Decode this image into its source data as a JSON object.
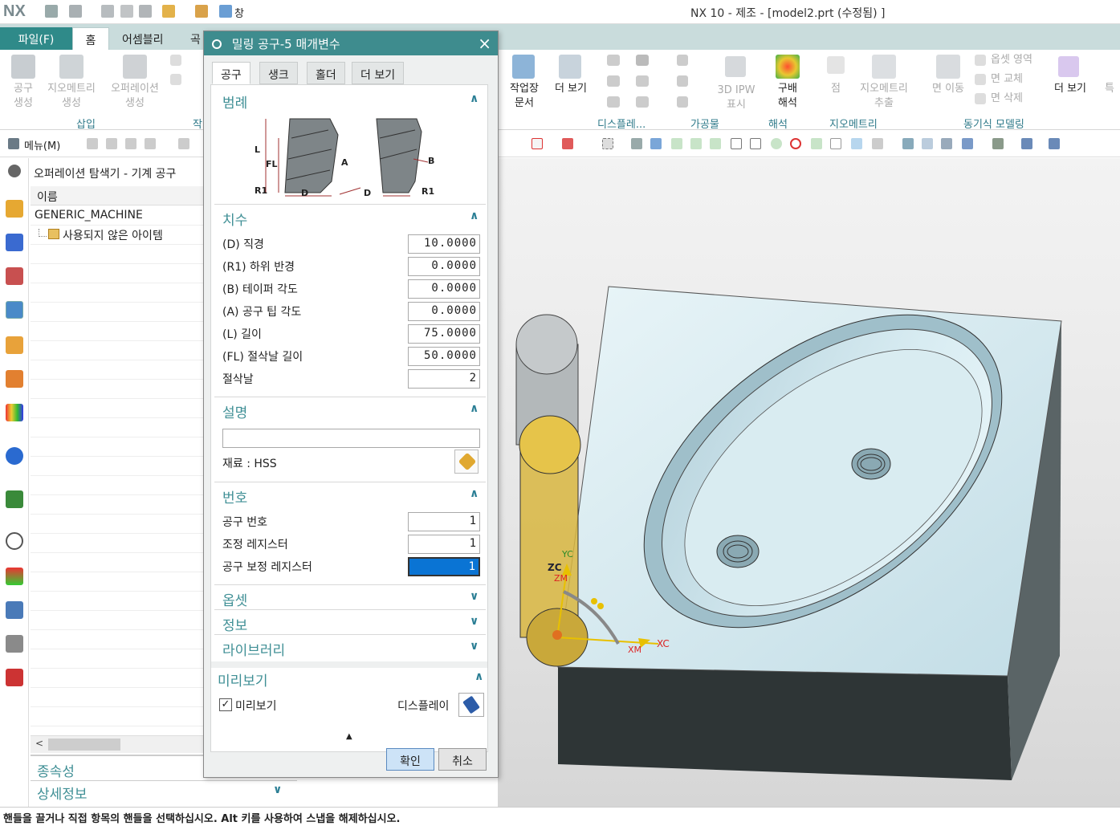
{
  "app": {
    "logo": "NX",
    "title": "NX 10 - 제조 - [model2.prt (수정됨) ]",
    "quick_access": [
      "save-icon",
      "undo-icon",
      "cut-icon",
      "copy-icon",
      "paste-icon",
      "update-icon",
      "window-label"
    ],
    "window_menu": "창"
  },
  "tabs": {
    "file": "파일(F)",
    "home": "홈",
    "assembly": "어셈블리",
    "more": "곡"
  },
  "ribbon": {
    "create_tool": "공구\n생성",
    "create_geometry": "지오메트리\n생성",
    "create_operation": "오퍼레이션\n생성",
    "group_insert": "삽입",
    "group_insert_cut": "작",
    "shop_doc": "작업장\n문서",
    "more_view": "더 보기",
    "group_display": "디스플레...",
    "ipw": "3D IPW\n표시",
    "group_machining": "가공물",
    "draft_analysis": "구배\n해석",
    "group_analysis": "해석",
    "point": "점",
    "extract_geometry": "지오메트리\n추출",
    "group_geometry": "지오메트리",
    "move_face": "면 이동",
    "offset_region": "옵셋 영역",
    "replace_face": "면 교체",
    "delete_face": "면 삭제",
    "group_sync": "동기식 모델링",
    "more_view2": "더 보기",
    "special": "특"
  },
  "menu_btn": "메뉴(M)",
  "navigator": {
    "title": "오퍼레이션 탐색기 - 기계 공구",
    "column_name": "이름",
    "rows": [
      "GENERIC_MACHINE",
      "사용되지 않은 아이템"
    ],
    "dependencies": "종속성",
    "details": "상세정보"
  },
  "dialog": {
    "title": "밀링 공구-5 매개변수",
    "tabs": [
      "공구",
      "생크",
      "홀더",
      "더 보기"
    ],
    "legend": {
      "title": "범례",
      "labels": [
        "L",
        "FL",
        "R1",
        "D",
        "A",
        "B",
        "D",
        "R1"
      ]
    },
    "dimensions": {
      "title": "치수",
      "rows": [
        {
          "label": "(D) 직경",
          "value": "10.0000"
        },
        {
          "label": "(R1) 하위 반경",
          "value": "0.0000"
        },
        {
          "label": "(B) 테이퍼 각도",
          "value": "0.0000"
        },
        {
          "label": "(A) 공구 팁 각도",
          "value": "0.0000"
        },
        {
          "label": "(L) 길이",
          "value": "75.0000"
        },
        {
          "label": "(FL) 절삭날 길이",
          "value": "50.0000"
        },
        {
          "label": "절삭날",
          "value": "2"
        }
      ]
    },
    "description": {
      "title": "설명",
      "value": "",
      "material": "재료 : HSS"
    },
    "numbers": {
      "title": "번호",
      "rows": [
        {
          "label": "공구 번호",
          "value": "1"
        },
        {
          "label": "조정 레지스터",
          "value": "1"
        },
        {
          "label": "공구 보정 레지스터",
          "value": "1"
        }
      ]
    },
    "collapsed": [
      "옵셋",
      "정보",
      "라이브러리"
    ],
    "preview": {
      "title": "미리보기",
      "checkbox": "미리보기",
      "checked": true,
      "display": "디스플레이"
    },
    "ok": "확인",
    "cancel": "취소"
  },
  "viewport": {
    "axes": [
      "ZC",
      "ZM",
      "XM",
      "XC",
      "YC"
    ]
  },
  "status": "핸들을 끌거나 직접 항목의 핸들을 선택하십시오. Alt 키를 사용하여 스냅을 해제하십시오."
}
